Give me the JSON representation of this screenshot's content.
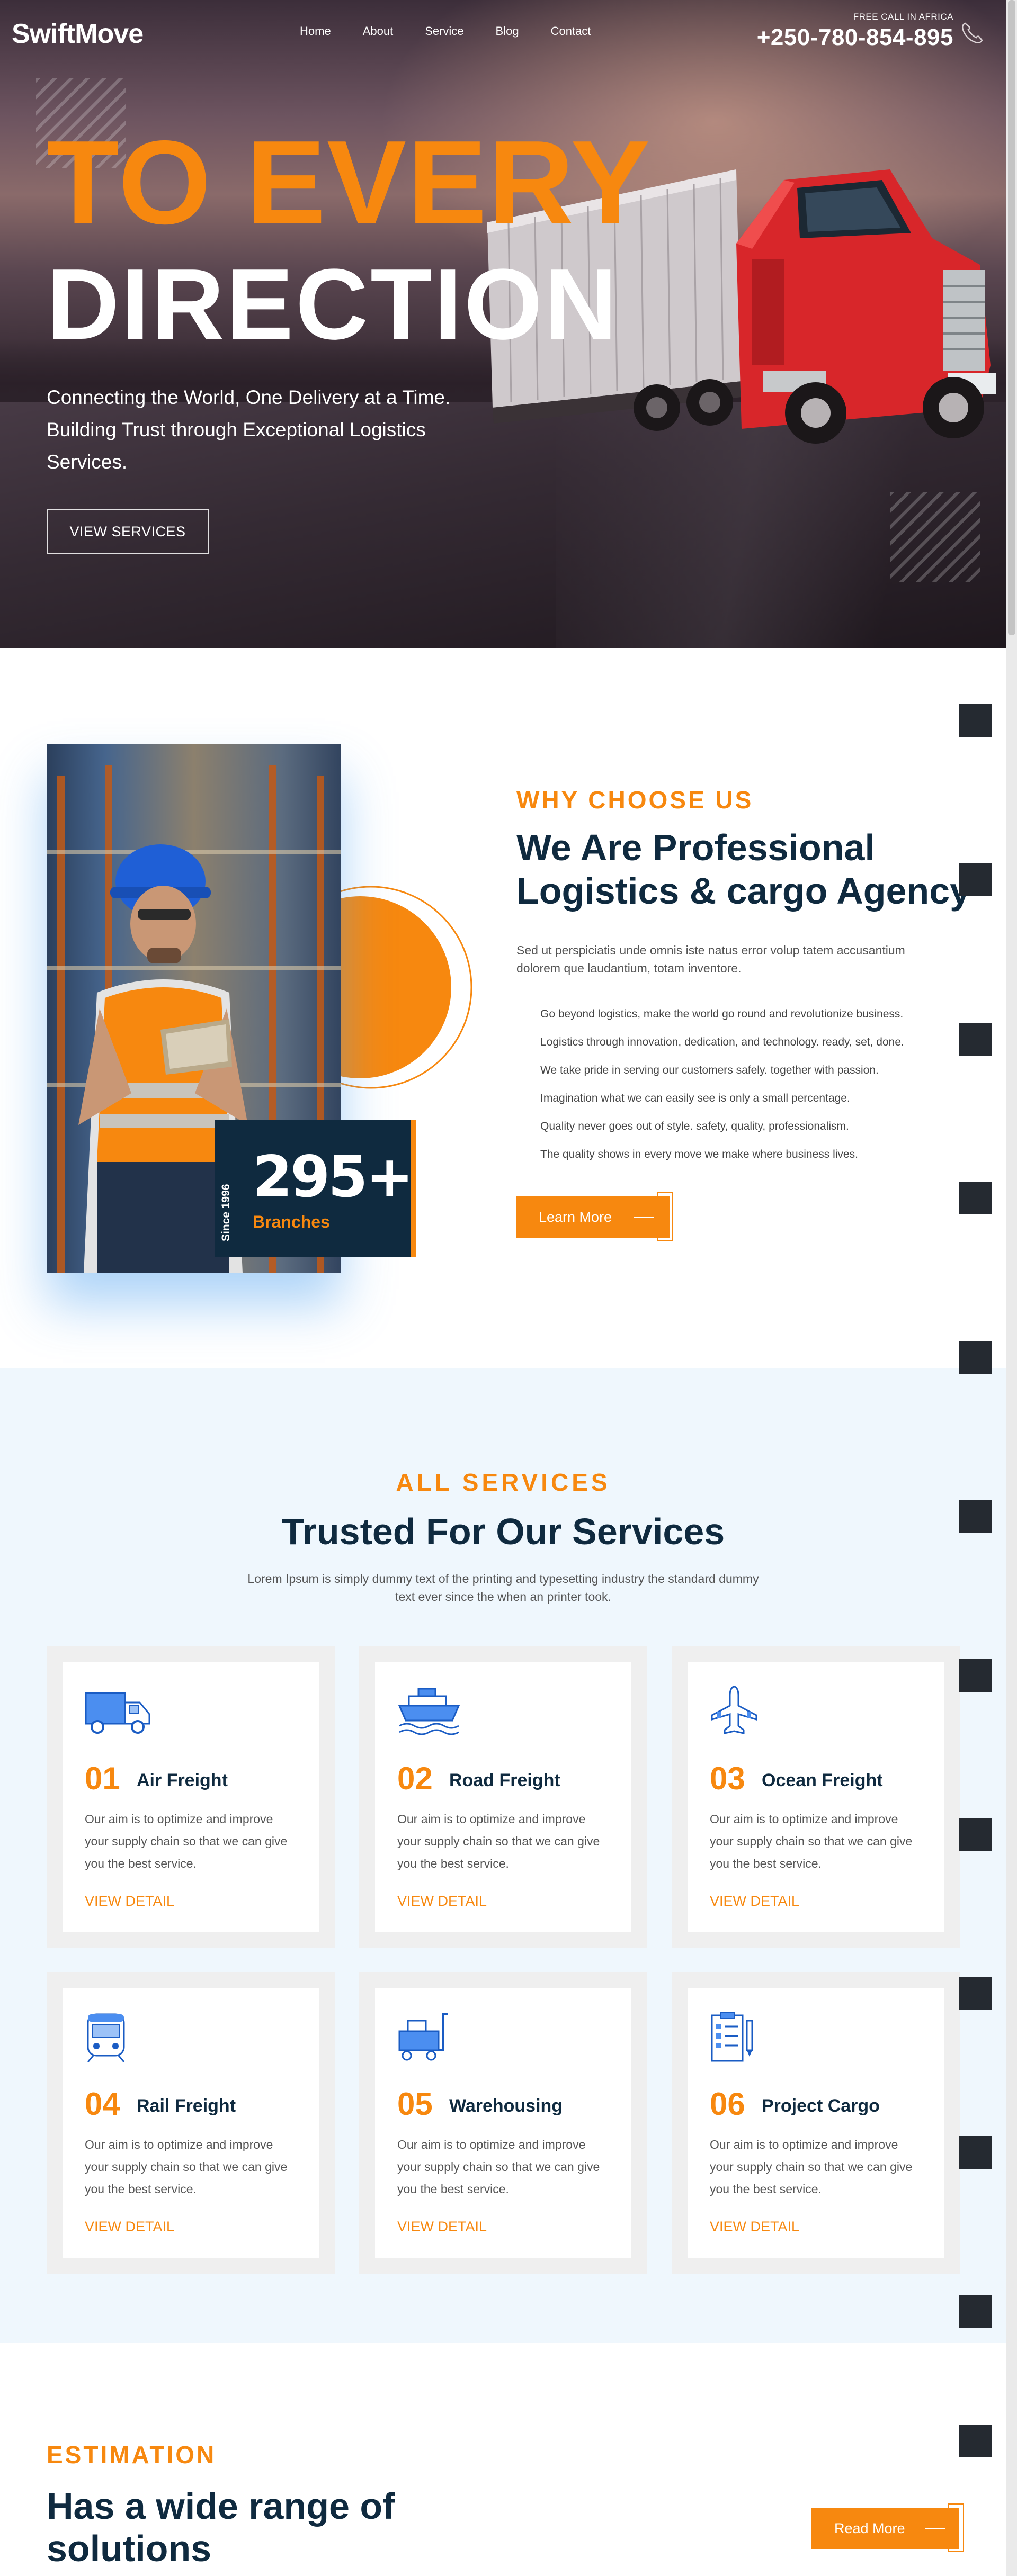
{
  "brand": {
    "name": "SwiftMove",
    "accent": "#f7880f",
    "navy": "#0f2a3f",
    "sky": "#eff7fd"
  },
  "nav": {
    "items": [
      "Home",
      "About",
      "Service",
      "Blog",
      "Contact"
    ]
  },
  "call": {
    "label": "FREE CALL IN AFRICA",
    "number": "+250-780-854-895",
    "icon": "phone-icon"
  },
  "hero": {
    "title_line1": "TO EVERY",
    "title_line2": "DIRECTION",
    "description": "Connecting the World, One Delivery at a Time. Building Trust through Exceptional Logistics Services.",
    "button": "VIEW SERVICES"
  },
  "about": {
    "stats_number": "295+",
    "stats_label": "Branches",
    "stats_since": "Since 1996",
    "label": "WHY CHOOSE US",
    "title": "We Are Professional Logistics & cargo Agency",
    "description": "Sed ut perspiciatis unde omnis iste natus error volup tatem accusantium dolorem que laudantium, totam inventore.",
    "points": [
      "Go beyond logistics, make the world go round and revolutionize business.",
      "Logistics through innovation, dedication, and technology. ready, set, done.",
      "We take pride in serving our customers safely. together with passion.",
      "Imagination what we can easily see is only a small percentage.",
      "Quality never goes out of style. safety, quality, professionalism.",
      "The quality shows in every move we make where business lives."
    ],
    "button": "Learn More"
  },
  "services": {
    "label": "ALL SERVICES",
    "title": "Trusted For Our Services",
    "description": "Lorem Ipsum is simply dummy text of the printing and typesetting industry the standard dummy text ever since the when an printer took.",
    "cards": [
      {
        "num": "01",
        "title": "Air Freight",
        "icon": "truck-icon",
        "text": "Our aim is to optimize and improve your supply chain so that we can give you the best service.",
        "link": "VIEW DETAIL"
      },
      {
        "num": "02",
        "title": "Road Freight",
        "icon": "ship-icon",
        "text": "Our aim is to optimize and improve your supply chain so that we can give you the best service.",
        "link": "VIEW DETAIL"
      },
      {
        "num": "03",
        "title": "Ocean Freight",
        "icon": "airplane-icon",
        "text": "Our aim is to optimize and improve your supply chain so that we can give you the best service.",
        "link": "VIEW DETAIL"
      },
      {
        "num": "04",
        "title": "Rail Freight",
        "icon": "train-icon",
        "text": "Our aim is to optimize and improve your supply chain so that we can give you the best service.",
        "link": "VIEW DETAIL"
      },
      {
        "num": "05",
        "title": "Warehousing",
        "icon": "cart-icon",
        "text": "Our aim is to optimize and improve your supply chain so that we can give you the best service.",
        "link": "VIEW DETAIL"
      },
      {
        "num": "06",
        "title": "Project Cargo",
        "icon": "clipboard-icon",
        "text": "Our aim is to optimize and improve your supply chain so that we can give you the best service.",
        "link": "VIEW DETAIL"
      }
    ]
  },
  "estimation": {
    "label": "ESTIMATION",
    "title": "Has a wide range of solutions",
    "button": "Read More"
  }
}
